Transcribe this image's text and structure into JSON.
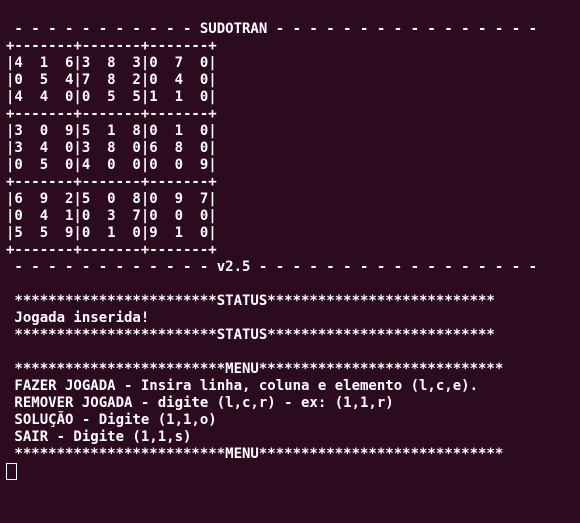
{
  "header": {
    "title_line": " - - - - - - - - - - - SUDOTRAN - - - - - - - - - - - - - - - -"
  },
  "board": {
    "divider": "+-------+-------+-------+",
    "rows": [
      "|4  1  6|3  8  3|0  7  0|",
      "|0  5  4|7  8  2|0  4  0|",
      "|4  4  0|0  5  5|1  1  0|",
      "|3  0  9|5  1  8|0  1  0|",
      "|3  4  0|3  8  0|6  8  0|",
      "|0  5  0|4  0  0|0  0  9|",
      "|6  9  2|5  0  8|0  9  7|",
      "|0  4  1|0  3  7|0  0  0|",
      "|5  5  9|0  1  0|9  1  0|"
    ]
  },
  "version": {
    "line": " - - - - - - - - - - - - v2.5 - - - - - - - - - - - - - - - - -"
  },
  "status": {
    "bar": " ************************STATUS***************************",
    "message": " Jogada inserida!"
  },
  "menu": {
    "bar": " *************************MENU*****************************",
    "line1": " FAZER JOGADA - Insira linha, coluna e elemento (l,c,e).",
    "line2": " REMOVER JOGADA - digite (l,c,r) - ex: (1,1,r)",
    "line3": " SOLUÇÃO - Digite (1,1,o)",
    "line4": " SAIR - Digite (1,1,s)"
  }
}
